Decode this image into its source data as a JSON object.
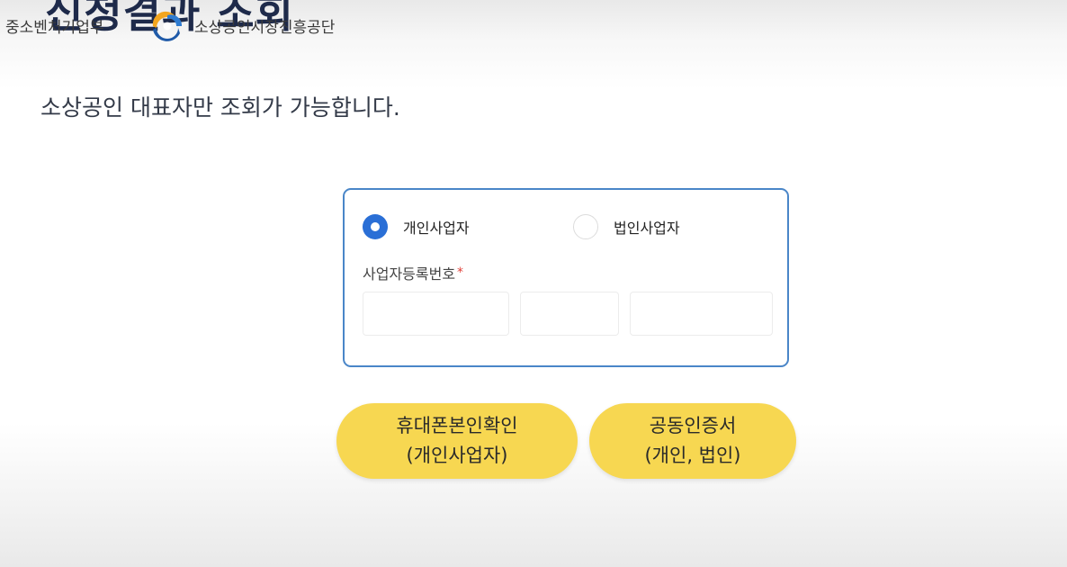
{
  "header": {
    "page_title": "신청결과 조회",
    "ministry_name": "중소벤처기업부",
    "agency_name": "소상공인시장진흥공단",
    "logo_icon": "government-taegeuk-logo-icon"
  },
  "notice": "소상공인 대표자만 조회가 가능합니다.",
  "form": {
    "business_type_options": [
      {
        "label": "개인사업자",
        "selected": true
      },
      {
        "label": "법인사업자",
        "selected": false
      }
    ],
    "registration_number_label": "사업자등록번호",
    "required_mark": "*",
    "registration_number_fields": [
      {
        "value": "",
        "placeholder": ""
      },
      {
        "value": "",
        "placeholder": ""
      },
      {
        "value": "",
        "placeholder": ""
      }
    ]
  },
  "auth_buttons": [
    {
      "line1": "휴대폰본인확인",
      "line2": "(개인사업자)"
    },
    {
      "line1": "공동인증서",
      "line2": "(개인, 법인)"
    }
  ],
  "colors": {
    "title": "#1e2a4a",
    "card_border": "#4a86c8",
    "radio_selected": "#2a6fd6",
    "required": "#e0413a",
    "button_yellow": "#f7d751"
  }
}
